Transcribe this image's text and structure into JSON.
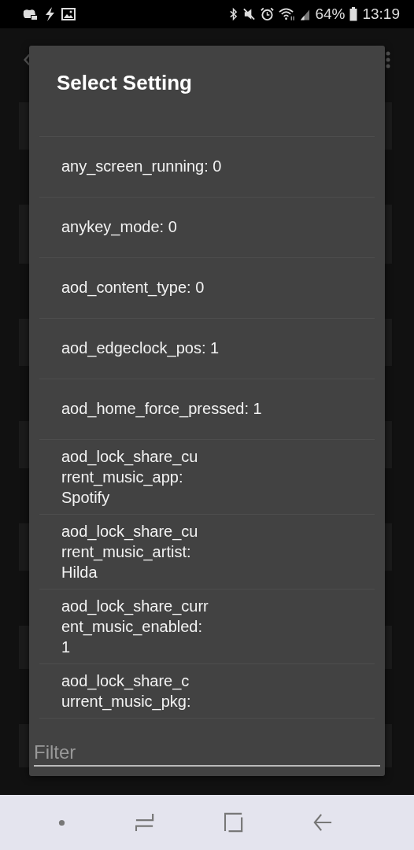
{
  "status_bar": {
    "battery": "64%",
    "time": "13:19"
  },
  "dialog": {
    "title": "Select Setting",
    "items": [
      {
        "label": "any_screen_running: 0"
      },
      {
        "label": "anykey_mode: 0"
      },
      {
        "label": "aod_content_type: 0"
      },
      {
        "label": "aod_edgeclock_pos: 1"
      },
      {
        "label": "aod_home_force_pressed: 1"
      },
      {
        "label": "aod_lock_share_cu\nrrent_music_app:\nSpotify"
      },
      {
        "label": "aod_lock_share_cu\nrrent_music_artist:\nHilda"
      },
      {
        "label": "aod_lock_share_curr\nent_music_enabled:\n1"
      },
      {
        "label": "aod_lock_share_c\nurrent_music_pkg:"
      }
    ],
    "filter": {
      "placeholder": "Filter"
    }
  }
}
